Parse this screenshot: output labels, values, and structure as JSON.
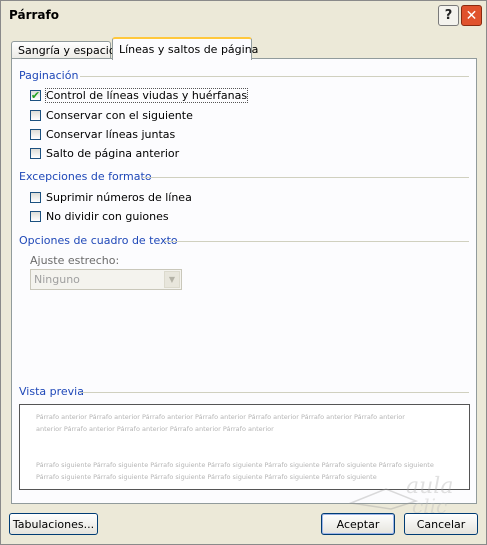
{
  "window": {
    "title": "Párrafo"
  },
  "titlebar": {
    "help_glyph": "?",
    "close_glyph": "✕"
  },
  "tabs": [
    {
      "label": "Sangría y espacio"
    },
    {
      "label": "Líneas y saltos de página"
    }
  ],
  "paginacion": {
    "heading": "Paginación",
    "options": [
      {
        "label": "Control de líneas viudas y huérfanas",
        "checked": true
      },
      {
        "label": "Conservar con el siguiente",
        "checked": false
      },
      {
        "label": "Conservar líneas juntas",
        "checked": false
      },
      {
        "label": "Salto de página anterior",
        "checked": false
      }
    ]
  },
  "excepciones": {
    "heading": "Excepciones de formato",
    "options": [
      {
        "label": "Suprimir números de línea",
        "checked": false
      },
      {
        "label": "No dividir con guiones",
        "checked": false
      }
    ]
  },
  "cuadro_texto": {
    "heading": "Opciones de cuadro de texto",
    "ajuste_label": "Ajuste estrecho:",
    "ajuste_value": "Ninguno"
  },
  "vista_previa": {
    "heading": "Vista previa",
    "line1": "Párrafo anterior Párrafo anterior Párrafo anterior Párrafo anterior Párrafo anterior Párrafo anterior Párrafo anterior",
    "line2": "anterior Párrafo anterior Párrafo anterior Párrafo anterior Párrafo anterior",
    "line3": "Párrafo siguiente Párrafo siguiente Párrafo siguiente Párrafo siguiente Párrafo siguiente Párrafo siguiente Párrafo siguiente",
    "line4": "Párrafo siguiente Párrafo siguiente Párrafo siguiente Párrafo siguiente Párrafo siguiente Párrafo siguiente"
  },
  "buttons": {
    "tabulaciones": "Tabulaciones...",
    "aceptar": "Aceptar",
    "cancelar": "Cancelar"
  },
  "check_glyph": "✔",
  "watermark_text": "aula clic"
}
